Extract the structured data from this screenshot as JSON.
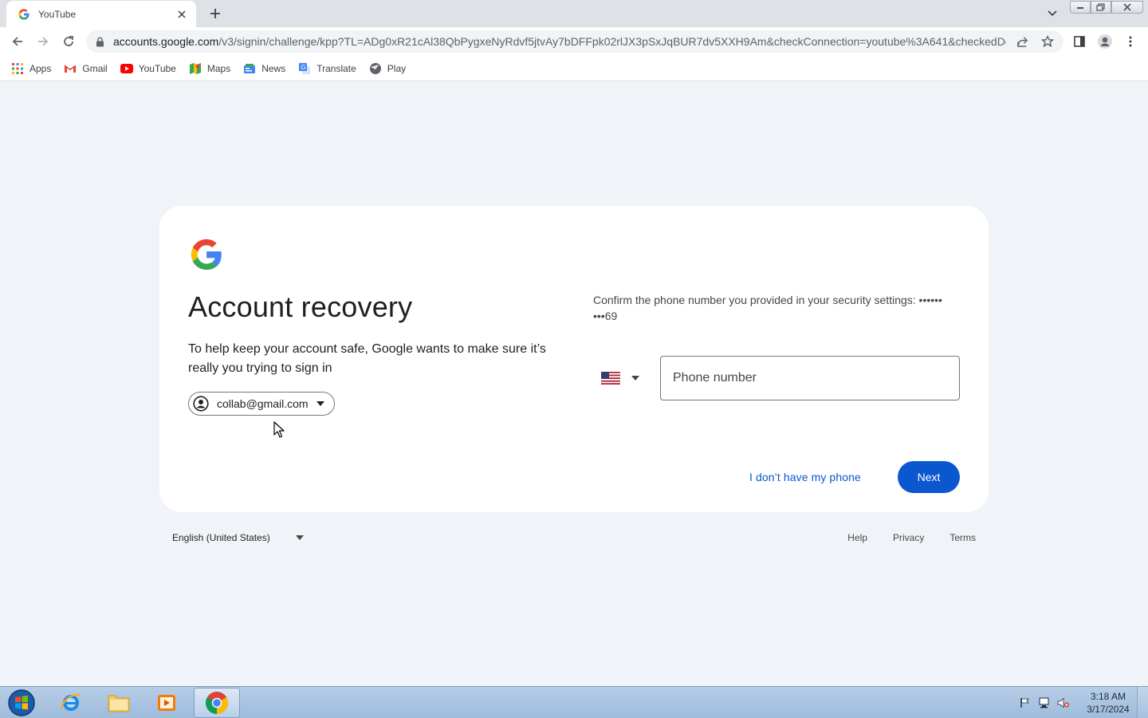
{
  "browser": {
    "tab_title": "YouTube",
    "url_host": "accounts.google.com",
    "url_path": "/v3/signin/challenge/kpp?TL=ADg0xR21cAl38QbPygxeNyRdvf5jtvAy7bDFFpk02rlJX3pSxJqBUR7dv5XXH9Am&checkConnection=youtube%3A641&checkedDo..."
  },
  "bookmarks": [
    {
      "label": "Apps",
      "icon": "apps-grid-icon"
    },
    {
      "label": "Gmail",
      "icon": "gmail-icon"
    },
    {
      "label": "YouTube",
      "icon": "youtube-icon"
    },
    {
      "label": "Maps",
      "icon": "maps-icon"
    },
    {
      "label": "News",
      "icon": "news-icon"
    },
    {
      "label": "Translate",
      "icon": "translate-icon"
    },
    {
      "label": "Play",
      "icon": "play-icon"
    }
  ],
  "page": {
    "title": "Account recovery",
    "subtitle": "To help keep your account safe, Google wants to make sure it’s really you trying to sign in",
    "account_email": "collab@gmail.com",
    "confirm_text": "Confirm the phone number you provided in your security settings: ••••••  •••69",
    "phone_placeholder": "Phone number",
    "phone_value": "",
    "no_phone_label": "I don’t have my phone",
    "next_label": "Next"
  },
  "footer": {
    "language": "English (United States)",
    "links": [
      "Help",
      "Privacy",
      "Terms"
    ]
  },
  "taskbar": {
    "time": "3:18 AM",
    "date": "3/17/2024"
  },
  "colors": {
    "primary": "#0b57d0",
    "page_bg": "#f0f4f9",
    "card_bg": "#ffffff"
  }
}
